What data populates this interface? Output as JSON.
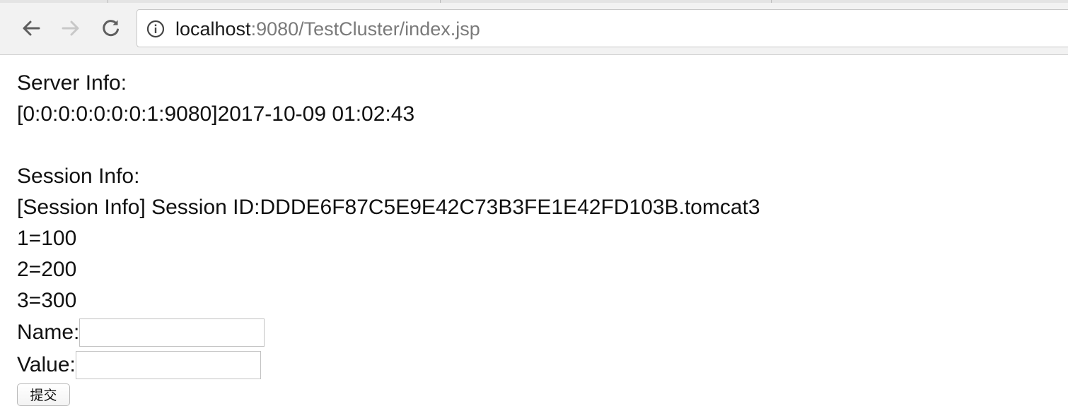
{
  "browser": {
    "url_host": "localhost",
    "url_rest": ":9080/TestCluster/index.jsp"
  },
  "page": {
    "server_info_label": "Server Info:",
    "server_info_value": "[0:0:0:0:0:0:0:1:9080]2017-10-09 01:02:43",
    "session_info_label": "Session Info:",
    "session_id_line": "[Session Info] Session ID:DDDE6F87C5E9E42C73B3FE1E42FD103B.tomcat3",
    "attributes": [
      "1=100",
      "2=200",
      "3=300"
    ],
    "name_label": "Name:",
    "name_value": "",
    "value_label": "Value:",
    "value_value": "",
    "submit_label": "提交"
  },
  "icons": {
    "back": "arrow-left-icon",
    "forward": "arrow-right-icon",
    "reload": "reload-icon",
    "site_info": "info-circle-icon"
  },
  "colors": {
    "url_host": "#1a1a1a",
    "url_rest": "#7a7a7a",
    "forward_disabled": "#c8c8c8"
  }
}
